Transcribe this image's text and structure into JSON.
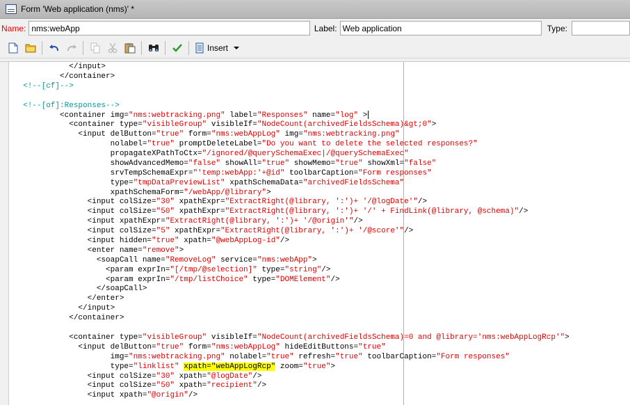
{
  "window": {
    "title": "Form 'Web application (nms)' *"
  },
  "fields": {
    "name_label": "Name:",
    "name_value": "nms:webApp",
    "label_label": "Label:",
    "label_value": "Web application",
    "type_label": "Type:",
    "type_value": ""
  },
  "toolbar": {
    "insert_label": "Insert",
    "buttons": [
      "new-document-icon",
      "open-folder-icon",
      "undo-icon",
      "redo-icon",
      "copy-icon",
      "cut-icon",
      "paste-icon",
      "find-binoculars-icon",
      "check-icon",
      "insert-icon"
    ]
  },
  "colors": {
    "tag": "#000000",
    "value": "#e00000",
    "comment": "#009a9a",
    "highlight": "#ffff00",
    "name_label": "#e00000"
  },
  "code_lines": [
    [
      [
        "t",
        "            </input>"
      ]
    ],
    [
      [
        "t",
        "          </container>"
      ]
    ],
    [
      [
        "c",
        "  <!--[cf]-->"
      ]
    ],
    [
      [
        "t",
        ""
      ]
    ],
    [
      [
        "c",
        "  <!--[of]:Responses-->"
      ]
    ],
    [
      [
        "t",
        "          <container img="
      ],
      [
        "v",
        "\"nms:webtracking.png\""
      ],
      [
        "t",
        " label="
      ],
      [
        "v",
        "\"Responses\""
      ],
      [
        "t",
        " name="
      ],
      [
        "v",
        "\"log\""
      ],
      [
        "t",
        " >"
      ]
    ],
    [
      [
        "t",
        "            <container type="
      ],
      [
        "v",
        "\"visibleGroup\""
      ],
      [
        "t",
        " visibleIf="
      ],
      [
        "v",
        "\"NodeCount(archivedFieldsSchema)&gt;0\""
      ],
      [
        "t",
        ">"
      ]
    ],
    [
      [
        "t",
        "              <input delButton="
      ],
      [
        "v",
        "\"true\""
      ],
      [
        "t",
        " form="
      ],
      [
        "v",
        "\"nms:webAppLog\""
      ],
      [
        "t",
        " img="
      ],
      [
        "v",
        "\"nms:webtracking.png\""
      ]
    ],
    [
      [
        "t",
        "                     nolabel="
      ],
      [
        "v",
        "\"true\""
      ],
      [
        "t",
        " promptDeleteLabel="
      ],
      [
        "v",
        "\"Do you want to delete the selected responses?\""
      ]
    ],
    [
      [
        "t",
        "                     propagateXPathToCtx="
      ],
      [
        "v",
        "\"/ignored/@querySchemaExec|/@querySchemaExec\""
      ]
    ],
    [
      [
        "t",
        "                     showAdvancedMemo="
      ],
      [
        "v",
        "\"false\""
      ],
      [
        "t",
        " showAll="
      ],
      [
        "v",
        "\"true\""
      ],
      [
        "t",
        " showMemo="
      ],
      [
        "v",
        "\"true\""
      ],
      [
        "t",
        " showXml="
      ],
      [
        "v",
        "\"false\""
      ]
    ],
    [
      [
        "t",
        "                     srvTempSchemaExpr="
      ],
      [
        "v",
        "\"'temp:webApp:'+@id\""
      ],
      [
        "t",
        " toolbarCaption="
      ],
      [
        "v",
        "\"Form responses\""
      ]
    ],
    [
      [
        "t",
        "                     type="
      ],
      [
        "v",
        "\"tmpDataPreviewList\""
      ],
      [
        "t",
        " xpathSchemaData="
      ],
      [
        "v",
        "\"archivedFieldsSchema\""
      ]
    ],
    [
      [
        "t",
        "                     xpathSchemaForm="
      ],
      [
        "v",
        "\"/webApp/@library\""
      ],
      [
        "t",
        ">"
      ]
    ],
    [
      [
        "t",
        "                <input colSize="
      ],
      [
        "v",
        "\"30\""
      ],
      [
        "t",
        " xpathExpr="
      ],
      [
        "v",
        "\"ExtractRight(@library, ':')+ '/@logDate'\""
      ],
      [
        "t",
        "/>"
      ]
    ],
    [
      [
        "t",
        "                <input colSize="
      ],
      [
        "v",
        "\"50\""
      ],
      [
        "t",
        " xpathExpr="
      ],
      [
        "v",
        "\"ExtractRight(@library, ':')+ '/' + FindLink(@library, @schema)\""
      ],
      [
        "t",
        "/>"
      ]
    ],
    [
      [
        "t",
        "                <input xpathExpr="
      ],
      [
        "v",
        "\"ExtractRight(@library, ':')+ '/@origin'\""
      ],
      [
        "t",
        "/>"
      ]
    ],
    [
      [
        "t",
        "                <input colSize="
      ],
      [
        "v",
        "\"5\""
      ],
      [
        "t",
        " xpathExpr="
      ],
      [
        "v",
        "\"ExtractRight(@library, ':')+ '/@score'\""
      ],
      [
        "t",
        "/>"
      ]
    ],
    [
      [
        "t",
        "                <input hidden="
      ],
      [
        "v",
        "\"true\""
      ],
      [
        "t",
        " xpath="
      ],
      [
        "v",
        "\"@webAppLog-id\""
      ],
      [
        "t",
        "/>"
      ]
    ],
    [
      [
        "t",
        "                <enter name="
      ],
      [
        "v",
        "\"remove\""
      ],
      [
        "t",
        ">"
      ]
    ],
    [
      [
        "t",
        "                  <soapCall name="
      ],
      [
        "v",
        "\"RemoveLog\""
      ],
      [
        "t",
        " service="
      ],
      [
        "v",
        "\"nms:webApp\""
      ],
      [
        "t",
        ">"
      ]
    ],
    [
      [
        "t",
        "                    <param exprIn="
      ],
      [
        "v",
        "\"[/tmp/@selection]\""
      ],
      [
        "t",
        " type="
      ],
      [
        "v",
        "\"string\""
      ],
      [
        "t",
        "/>"
      ]
    ],
    [
      [
        "t",
        "                    <param exprIn="
      ],
      [
        "v",
        "\"/tmp/listChoice\""
      ],
      [
        "t",
        " type="
      ],
      [
        "v",
        "\"DOMElement\""
      ],
      [
        "t",
        "/>"
      ]
    ],
    [
      [
        "t",
        "                  </soapCall>"
      ]
    ],
    [
      [
        "t",
        "                </enter>"
      ]
    ],
    [
      [
        "t",
        "              </input>"
      ]
    ],
    [
      [
        "t",
        "            </container>"
      ]
    ],
    [
      [
        "t",
        ""
      ]
    ],
    [
      [
        "t",
        "            <container type="
      ],
      [
        "v",
        "\"visibleGroup\""
      ],
      [
        "t",
        " visibleIf="
      ],
      [
        "v",
        "\"NodeCount(archivedFieldsSchema)=0 and @library='nms:webAppLogRcp'\""
      ],
      [
        "t",
        ">"
      ]
    ],
    [
      [
        "t",
        "              <input delButton="
      ],
      [
        "v",
        "\"true\""
      ],
      [
        "t",
        " form="
      ],
      [
        "v",
        "\"nms:webAppLog\""
      ],
      [
        "t",
        " hideEditButtons="
      ],
      [
        "v",
        "\"true\""
      ]
    ],
    [
      [
        "t",
        "                     img="
      ],
      [
        "v",
        "\"nms:webtracking.png\""
      ],
      [
        "t",
        " nolabel="
      ],
      [
        "v",
        "\"true\""
      ],
      [
        "t",
        " refresh="
      ],
      [
        "v",
        "\"true\""
      ],
      [
        "t",
        " toolbarCaption="
      ],
      [
        "v",
        "\"Form responses\""
      ]
    ],
    [
      [
        "t",
        "                     type="
      ],
      [
        "v",
        "\"linklist\""
      ],
      [
        "t",
        " "
      ],
      [
        "h",
        "xpath=\"webAppLogRcp\""
      ],
      [
        "t",
        " zoom="
      ],
      [
        "v",
        "\"true\""
      ],
      [
        "t",
        ">"
      ]
    ],
    [
      [
        "t",
        "                <input colSize="
      ],
      [
        "v",
        "\"30\""
      ],
      [
        "t",
        " xpath="
      ],
      [
        "v",
        "\"@logDate\""
      ],
      [
        "t",
        "/>"
      ]
    ],
    [
      [
        "t",
        "                <input colSize="
      ],
      [
        "v",
        "\"50\""
      ],
      [
        "t",
        " xpath="
      ],
      [
        "v",
        "\"recipient\""
      ],
      [
        "t",
        "/>"
      ]
    ],
    [
      [
        "t",
        "                <input xpath="
      ],
      [
        "v",
        "\"@origin\""
      ],
      [
        "t",
        "/>"
      ]
    ]
  ]
}
